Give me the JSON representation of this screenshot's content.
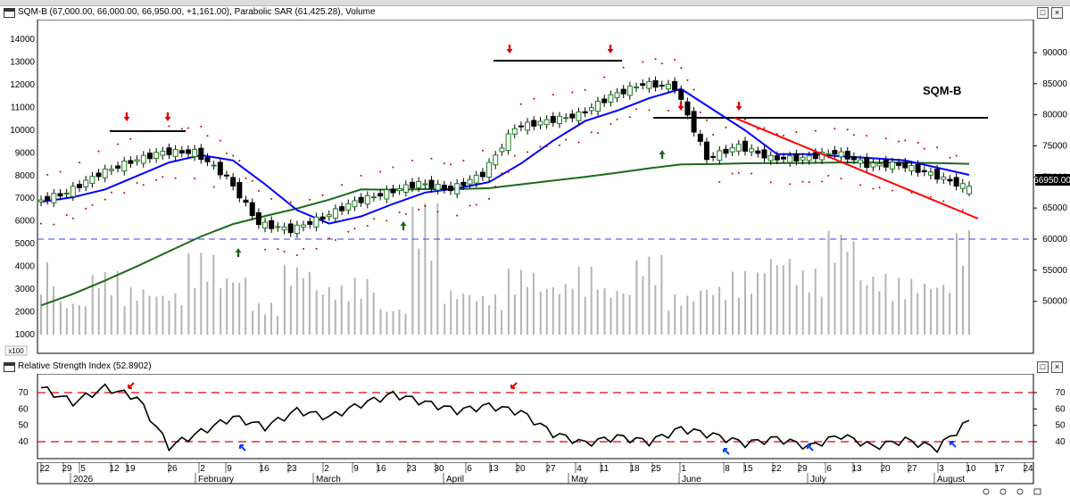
{
  "price_panel": {
    "header_text": "SQM-B (67,000.00, 66,000.00, 66,950.00, +1,161.00), Parabolic SAR (61,425.28), Volume",
    "symbol_label": "SQM-B",
    "last_price_tag": "66950.00",
    "volume_scale_label": "x100",
    "left_axis_ticks": [
      "14000",
      "13000",
      "12000",
      "11000",
      "10000",
      "9000",
      "8000",
      "7000",
      "6000",
      "5000",
      "4000",
      "3000",
      "2000",
      "1000"
    ],
    "right_axis_ticks": [
      "90000",
      "85000",
      "80000",
      "75000",
      "70000",
      "65000",
      "60000",
      "55000",
      "50000"
    ],
    "colors": {
      "candle_up": "#1e7a1e",
      "candle_down": "#000000",
      "ma_short": "#0000ff",
      "ma_long": "#1a6a1a",
      "sar": "#c00000",
      "trendline": "#ff0000",
      "support": "#0000ff",
      "volume": "#b4b4b4",
      "arrow_sell": "#e00000",
      "arrow_buy": "#1a6a1a"
    }
  },
  "rsi_panel": {
    "header_text": "Relative Strength Index (52.8902)",
    "right_axis_ticks": [
      "70",
      "60",
      "50",
      "40"
    ],
    "levels": [
      70,
      40
    ],
    "colors": {
      "line": "#000000",
      "level": "#e00000",
      "arrow_top": "#e00000",
      "arrow_bottom": "#0040ff"
    }
  },
  "x_axis": {
    "day_labels": [
      "22",
      "29",
      "5",
      "12",
      "19",
      "26",
      "2",
      "9",
      "16",
      "23",
      "2",
      "9",
      "16",
      "23",
      "30",
      "6",
      "13",
      "20",
      "27",
      "4",
      "11",
      "18",
      "25",
      "1",
      "8",
      "15",
      "22",
      "29",
      "6",
      "13",
      "20",
      "27",
      "3",
      "10",
      "17",
      "24"
    ],
    "month_labels": [
      "2026",
      "February",
      "March",
      "April",
      "May",
      "June",
      "July",
      "August"
    ]
  },
  "chart_data": [
    {
      "type": "candlestick",
      "title": "SQM-B",
      "series": [
        {
          "name": "SQM-B",
          "last_close": 66950,
          "change": 1161,
          "high": 67000,
          "low": 66000
        },
        {
          "name": "Parabolic SAR",
          "last_value": 61425.28
        },
        {
          "name": "Volume"
        }
      ],
      "x": [
        "Jan 20",
        "Jan 27",
        "Feb 3",
        "Feb 10",
        "Feb 17",
        "Feb 24",
        "Mar 3",
        "Mar 10",
        "Mar 17",
        "Mar 24",
        "Mar 31",
        "Apr 7",
        "Apr 14",
        "Apr 21",
        "Apr 28",
        "May 5",
        "May 12",
        "May 19",
        "May 26",
        "Jun 2",
        "Jun 9",
        "Jun 16",
        "Jun 23",
        "Jun 30",
        "Jul 7",
        "Jul 14",
        "Jul 21",
        "Jul 28",
        "Aug 4",
        "Aug 7"
      ],
      "price_close": [
        66000,
        67500,
        70500,
        72500,
        74000,
        74000,
        70000,
        62500,
        61500,
        63500,
        66000,
        67500,
        69000,
        68000,
        70500,
        78000,
        79000,
        80000,
        83000,
        85000,
        84500,
        73000,
        75000,
        73000,
        73000,
        74000,
        72000,
        72000,
        70500,
        68500
      ],
      "ylim_price": [
        48000,
        91000
      ],
      "volume_x100": [
        4200,
        2500,
        3800,
        3100,
        2900,
        4600,
        3700,
        2400,
        4100,
        3200,
        3500,
        2200,
        6800,
        3000,
        2800,
        3900,
        3300,
        4000,
        3100,
        4500,
        2800,
        3200,
        3800,
        4600,
        3900,
        5600,
        3700,
        3500,
        3400,
        5600
      ],
      "ylim_volume_x100": [
        1000,
        14000
      ],
      "support_level": 60000,
      "resistance_levels": [
        75800,
        85000,
        74000
      ]
    },
    {
      "type": "line",
      "title": "Relative Strength Index",
      "last_value": 52.8902,
      "x": [
        "Jan 20",
        "Jan 27",
        "Feb 3",
        "Feb 10",
        "Feb 17",
        "Feb 24",
        "Mar 3",
        "Mar 10",
        "Mar 17",
        "Mar 24",
        "Mar 31",
        "Apr 7",
        "Apr 14",
        "Apr 21",
        "Apr 28",
        "May 5",
        "May 12",
        "May 19",
        "May 26",
        "Jun 2",
        "Jun 9",
        "Jun 16",
        "Jun 23",
        "Jun 30",
        "Jul 7",
        "Jul 14",
        "Jul 21",
        "Jul 28",
        "Aug 4",
        "Aug 7"
      ],
      "values": [
        73,
        64,
        73,
        67,
        37,
        46,
        55,
        49,
        59,
        55,
        63,
        69,
        64,
        59,
        62,
        58,
        45,
        39,
        43,
        40,
        48,
        44,
        39,
        42,
        37,
        44,
        37,
        41,
        36,
        53
      ],
      "ylim": [
        30,
        80
      ]
    }
  ]
}
